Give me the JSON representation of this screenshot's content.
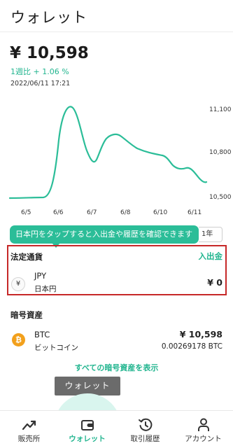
{
  "header": {
    "title": "ウォレット"
  },
  "summary": {
    "balance": "¥ 10,598",
    "change": "1週比 + 1.06 %",
    "timestamp": "2022/06/11 17:21"
  },
  "chart_data": {
    "type": "line",
    "x_tick_labels": [
      "6/5",
      "6/6",
      "6/7",
      "6/8",
      "6/10",
      "6/11"
    ],
    "y_tick_labels": [
      "11,100",
      "10,800",
      "10,500"
    ],
    "ylim": [
      10450,
      11150
    ],
    "series": [
      {
        "color": "#2bbd98",
        "points": [
          [
            "6/5",
            10500
          ],
          [
            "6/5.5",
            10505
          ],
          [
            "6/6",
            10700
          ],
          [
            "6/6.2",
            11000
          ],
          [
            "6/6.45",
            11100
          ],
          [
            "6/6.7",
            11050
          ],
          [
            "6/7",
            10700
          ],
          [
            "6/7.3",
            10650
          ],
          [
            "6/7.6",
            10800
          ],
          [
            "6/8",
            10900
          ],
          [
            "6/8.4",
            10820
          ],
          [
            "6/9",
            10720
          ],
          [
            "6/10",
            10620
          ],
          [
            "6/10.3",
            10640
          ],
          [
            "6/10.7",
            10570
          ],
          [
            "6/11",
            10560
          ]
        ]
      }
    ],
    "grid": false
  },
  "tooltip": {
    "text": "日本円をタップすると入出金や履歴を確認できます"
  },
  "period_button": {
    "label": "1年"
  },
  "fiat": {
    "title": "法定通貨",
    "deposit_link": "入出金",
    "icon": "yen-icon",
    "icon_glyph": "¥",
    "code": "JPY",
    "name": "日本円",
    "amount": "¥ 0"
  },
  "crypto": {
    "title": "暗号資産",
    "items": [
      {
        "icon": "bitcoin-icon",
        "icon_glyph": "₿",
        "code": "BTC",
        "name": "ビットコイン",
        "jpy_value": "¥ 10,598",
        "amount": "0.00269178 BTC"
      }
    ],
    "show_all": "すべての暗号資産を表示"
  },
  "toast": {
    "text": "ウォレット"
  },
  "bottom_nav": {
    "items": [
      {
        "label": "販売所",
        "icon": "trend-up-icon"
      },
      {
        "label": "ウォレット",
        "icon": "wallet-icon"
      },
      {
        "label": "取引履歴",
        "icon": "history-icon"
      },
      {
        "label": "アカウント",
        "icon": "person-icon"
      }
    ],
    "active_index": 1
  },
  "colors": {
    "accent": "#22b58f",
    "highlight_border": "#c62828",
    "bitcoin": "#f2a01c"
  }
}
